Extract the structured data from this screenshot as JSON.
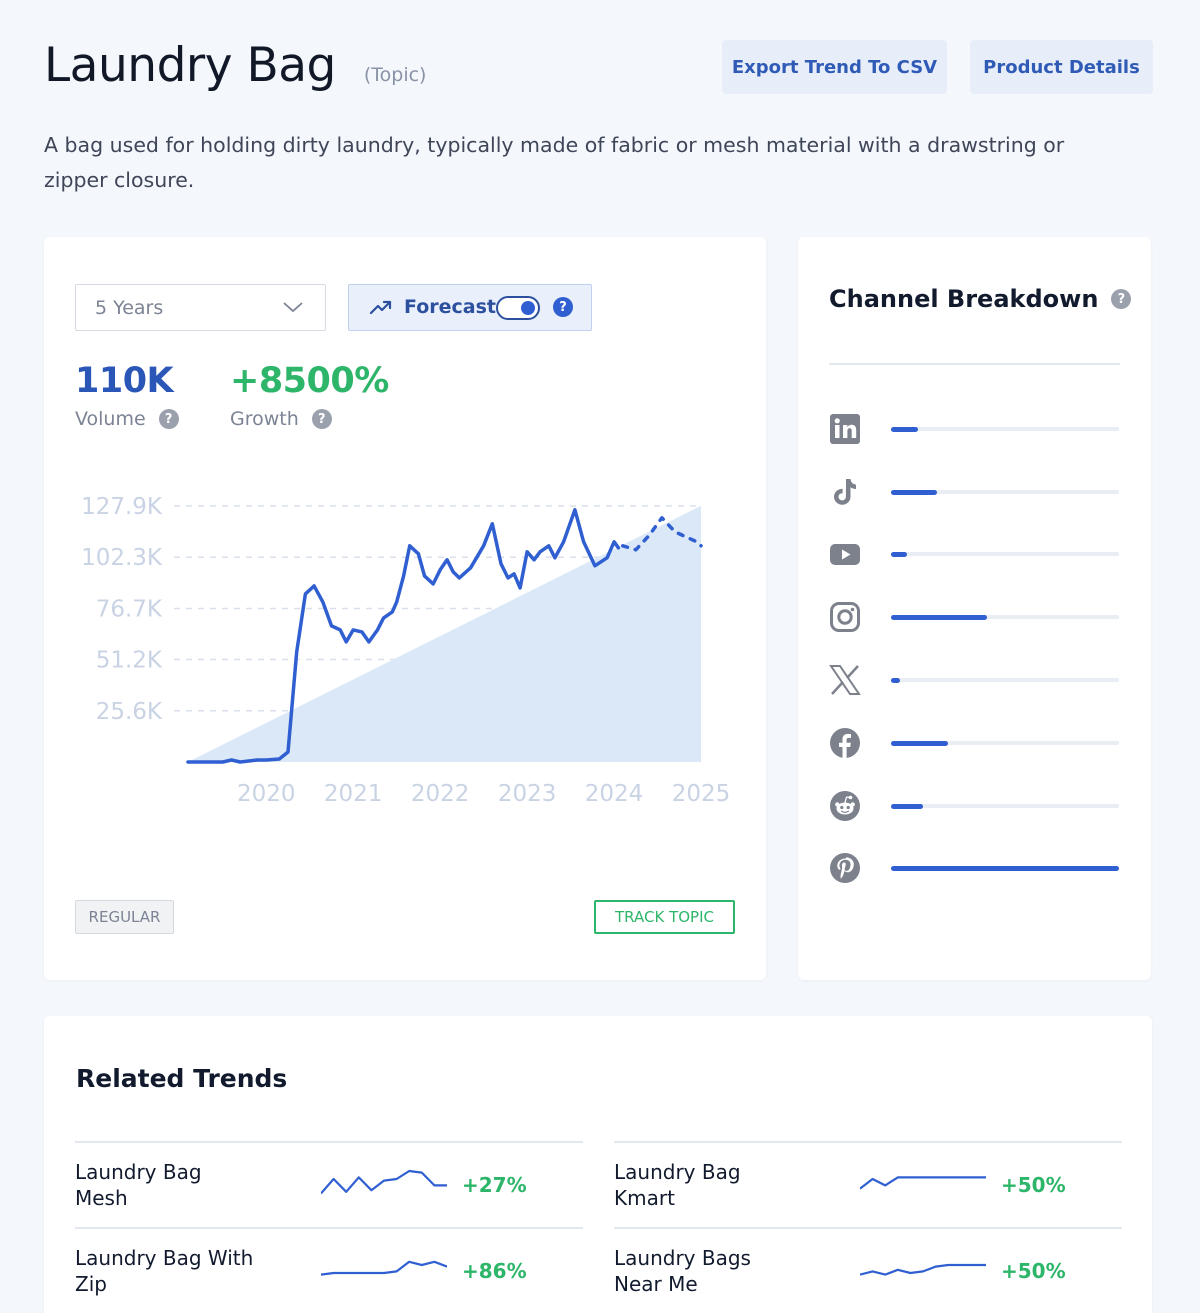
{
  "header": {
    "title": "Laundry Bag",
    "tag": "(Topic)",
    "export_label": "Export Trend To CSV",
    "details_label": "Product Details"
  },
  "description": "A bag used for holding dirty laundry, typically made of fabric or mesh material with a drawstring or zipper closure.",
  "controls": {
    "range_value": "5 Years",
    "forecast_label": "Forecast",
    "forecast_enabled": true
  },
  "metrics": {
    "volume_value": "110K",
    "volume_label": "Volume",
    "growth_value": "+8500%",
    "growth_label": "Growth"
  },
  "chart_data": {
    "type": "line",
    "y_ticks": [
      "127.9K",
      "102.3K",
      "76.7K",
      "51.2K",
      "25.6K"
    ],
    "x_ticks": [
      "2020",
      "2021",
      "2022",
      "2023",
      "2024",
      "2025"
    ],
    "ylim": [
      0,
      127900
    ],
    "xlim": [
      2019.1,
      2025.0
    ],
    "grid": true,
    "series": [
      {
        "style": "solid",
        "points": [
          [
            2019.1,
            0
          ],
          [
            2019.3,
            0
          ],
          [
            2019.5,
            0
          ],
          [
            2019.6,
            1000
          ],
          [
            2019.7,
            0
          ],
          [
            2019.9,
            1000
          ],
          [
            2020.0,
            1000
          ],
          [
            2020.15,
            1500
          ],
          [
            2020.25,
            5000
          ],
          [
            2020.35,
            55000
          ],
          [
            2020.45,
            84000
          ],
          [
            2020.55,
            88000
          ],
          [
            2020.65,
            80000
          ],
          [
            2020.75,
            68000
          ],
          [
            2020.85,
            66000
          ],
          [
            2020.92,
            60000
          ],
          [
            2021.0,
            66000
          ],
          [
            2021.1,
            65000
          ],
          [
            2021.18,
            60000
          ],
          [
            2021.28,
            66000
          ],
          [
            2021.35,
            72000
          ],
          [
            2021.45,
            75000
          ],
          [
            2021.5,
            80000
          ],
          [
            2021.58,
            93000
          ],
          [
            2021.65,
            108000
          ],
          [
            2021.75,
            104000
          ],
          [
            2021.82,
            93000
          ],
          [
            2021.92,
            89000
          ],
          [
            2022.0,
            96000
          ],
          [
            2022.08,
            101000
          ],
          [
            2022.15,
            95000
          ],
          [
            2022.22,
            92000
          ],
          [
            2022.35,
            97000
          ],
          [
            2022.5,
            108000
          ],
          [
            2022.6,
            119000
          ],
          [
            2022.7,
            99000
          ],
          [
            2022.78,
            92000
          ],
          [
            2022.85,
            94000
          ],
          [
            2022.92,
            87000
          ],
          [
            2023.0,
            105000
          ],
          [
            2023.08,
            101000
          ],
          [
            2023.15,
            105000
          ],
          [
            2023.25,
            108000
          ],
          [
            2023.32,
            102000
          ],
          [
            2023.42,
            110000
          ],
          [
            2023.55,
            126000
          ],
          [
            2023.65,
            110000
          ],
          [
            2023.78,
            98000
          ],
          [
            2023.92,
            102000
          ],
          [
            2024.0,
            110000
          ],
          [
            2024.05,
            107000
          ]
        ]
      },
      {
        "style": "dashed",
        "points": [
          [
            2024.1,
            108000
          ],
          [
            2024.25,
            106000
          ],
          [
            2024.4,
            113000
          ],
          [
            2024.55,
            122000
          ],
          [
            2024.7,
            115000
          ],
          [
            2024.85,
            112000
          ],
          [
            2024.95,
            110000
          ],
          [
            2025.0,
            108000
          ]
        ]
      }
    ],
    "band": {
      "style": "shaded",
      "points": [
        [
          2019.1,
          0
        ],
        [
          2025.0,
          128000
        ]
      ]
    }
  },
  "tags": {
    "regular_label": "REGULAR",
    "track_label": "TRACK TOPIC"
  },
  "channels": {
    "title": "Channel Breakdown",
    "accent": "#2f5fd0",
    "items": [
      {
        "icon": "linkedin-icon",
        "share": 0.12
      },
      {
        "icon": "tiktok-icon",
        "share": 0.2
      },
      {
        "icon": "youtube-icon",
        "share": 0.07
      },
      {
        "icon": "instagram-icon",
        "share": 0.42
      },
      {
        "icon": "x-icon",
        "share": 0.04
      },
      {
        "icon": "facebook-icon",
        "share": 0.25
      },
      {
        "icon": "reddit-icon",
        "share": 0.14
      },
      {
        "icon": "pinterest-icon",
        "share": 1.0
      }
    ]
  },
  "related": {
    "title": "Related Trends",
    "items": [
      {
        "name": "Laundry Bag Mesh",
        "growth": "+27%",
        "spark": [
          0.3,
          0.75,
          0.35,
          0.8,
          0.4,
          0.7,
          0.75,
          1.0,
          0.95,
          0.55,
          0.55
        ]
      },
      {
        "name": "Laundry Bag Kmart",
        "growth": "+50%",
        "spark": [
          0.45,
          0.75,
          0.55,
          0.8,
          0.8,
          0.8,
          0.8,
          0.8,
          0.8,
          0.8,
          0.8
        ]
      },
      {
        "name": "Laundry Bag With Zip",
        "growth": "+86%",
        "spark": [
          0.45,
          0.5,
          0.5,
          0.5,
          0.5,
          0.5,
          0.55,
          0.85,
          0.75,
          0.85,
          0.7
        ]
      },
      {
        "name": "Laundry Bags Near Me",
        "growth": "+50%",
        "spark": [
          0.45,
          0.55,
          0.45,
          0.6,
          0.5,
          0.55,
          0.7,
          0.75,
          0.75,
          0.75,
          0.75
        ]
      }
    ]
  },
  "colors": {
    "accent_blue": "#2f5fd0",
    "growth_green": "#2db56a",
    "forecast_fill": "#dbe8f8"
  }
}
